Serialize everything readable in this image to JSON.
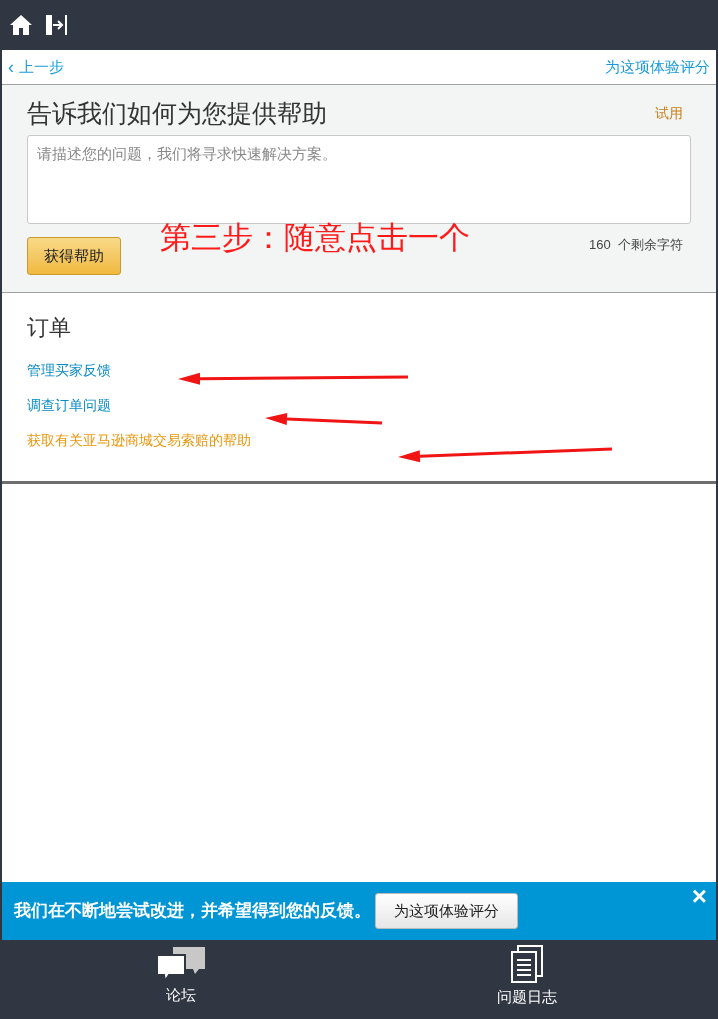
{
  "nav": {
    "back": {
      "icon": "‹",
      "label": "上一步"
    },
    "rate_link": "为这项体验评分"
  },
  "help": {
    "title": "告诉我们如何为您提供帮助",
    "beta": "试用",
    "placeholder": "请描述您的问题，我们将寻求快速解决方案。",
    "button": "获得帮助",
    "counter": "160  个剩余字符"
  },
  "annotation": {
    "text": "第三步：随意点击一个"
  },
  "orders": {
    "title": "订单",
    "links": [
      {
        "label": "管理买家反馈",
        "color": "#0a8bc4"
      },
      {
        "label": "调查订单问题",
        "color": "#0a8bc4"
      },
      {
        "label": "获取有关亚马逊商城交易索赔的帮助",
        "color": "#e8960c"
      }
    ]
  },
  "feedback_banner": {
    "text": "我们在不断地尝试改进，并希望得到您的反馈。",
    "button": "为这项体验评分",
    "close": "×"
  },
  "bottom_bar": [
    {
      "kind": "forum",
      "label": "论坛"
    },
    {
      "kind": "log",
      "label": "问题日志"
    }
  ]
}
